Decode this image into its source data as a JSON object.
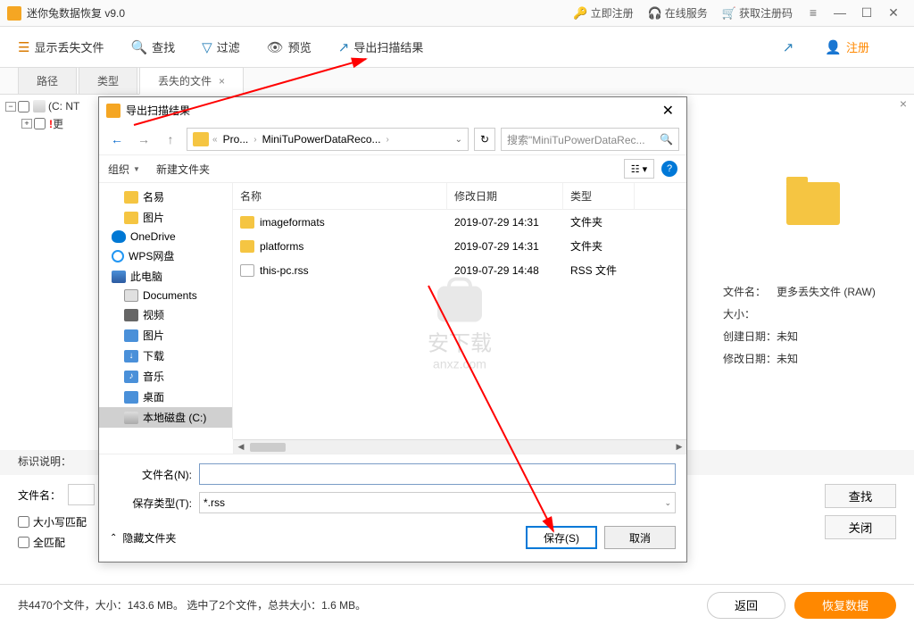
{
  "app": {
    "title": "迷你兔数据恢复  v9.0",
    "register": "立即注册",
    "online": "在线服务",
    "getcode": "获取注册码"
  },
  "toolbar": {
    "showlost": "显示丢失文件",
    "search": "查找",
    "filter": "过滤",
    "preview": "预览",
    "export": "导出扫描结果",
    "register": "注册"
  },
  "tabs": {
    "path": "路径",
    "type": "类型",
    "lost": "丢失的文件"
  },
  "tree": {
    "root": "(C: NT",
    "more": "更"
  },
  "info": {
    "filename_label": "文件名：",
    "filename": "更多丢失文件 (RAW)",
    "size_label": "大小：",
    "size": "",
    "created_label": "创建日期：",
    "created": "未知",
    "modified_label": "修改日期：",
    "modified": "未知"
  },
  "mark_label": "标识说明：",
  "bottom": {
    "filename_label": "文件名：",
    "match_case": "大小写匹配",
    "match_whole": "全匹配",
    "find_btn": "查找",
    "close_btn": "关闭"
  },
  "status": {
    "text": "共4470个文件，大小：143.6 MB。 选中了2个文件，总共大小：1.6 MB。",
    "back": "返回",
    "recover": "恢复数据"
  },
  "dialog": {
    "title": "导出扫描结果",
    "crumbs": [
      "Pro...",
      "MiniTuPowerDataReco..."
    ],
    "search_placeholder": "搜索\"MiniTuPowerDataRec...",
    "organize": "组织",
    "newfolder": "新建文件夹",
    "columns": {
      "name": "名称",
      "date": "修改日期",
      "type": "类型"
    },
    "tree": [
      {
        "icon": "folder",
        "label": "名易",
        "lv": 2
      },
      {
        "icon": "folder",
        "label": "图片",
        "lv": 2
      },
      {
        "icon": "onedrive",
        "label": "OneDrive",
        "lv": 1
      },
      {
        "icon": "wps",
        "label": "WPS网盘",
        "lv": 1
      },
      {
        "icon": "pc",
        "label": "此电脑",
        "lv": 1
      },
      {
        "icon": "doc",
        "label": "Documents",
        "lv": 2
      },
      {
        "icon": "video",
        "label": "视频",
        "lv": 2
      },
      {
        "icon": "image",
        "label": "图片",
        "lv": 2
      },
      {
        "icon": "download",
        "label": "下载",
        "lv": 2
      },
      {
        "icon": "music",
        "label": "音乐",
        "lv": 2
      },
      {
        "icon": "desktop",
        "label": "桌面",
        "lv": 2
      },
      {
        "icon": "disk",
        "label": "本地磁盘 (C:)",
        "lv": 2,
        "sel": true
      }
    ],
    "files": [
      {
        "icon": "folder",
        "name": "imageformats",
        "date": "2019-07-29 14:31",
        "type": "文件夹"
      },
      {
        "icon": "folder",
        "name": "platforms",
        "date": "2019-07-29 14:31",
        "type": "文件夹"
      },
      {
        "icon": "file",
        "name": "this-pc.rss",
        "date": "2019-07-29 14:48",
        "type": "RSS 文件"
      }
    ],
    "filename_label": "文件名(N):",
    "filename_value": "",
    "savetype_label": "保存类型(T):",
    "savetype_value": "*.rss",
    "hide_folders": "隐藏文件夹",
    "save_btn": "保存(S)",
    "cancel_btn": "取消",
    "watermark": "安下载",
    "watermark_url": "anxz.com"
  }
}
